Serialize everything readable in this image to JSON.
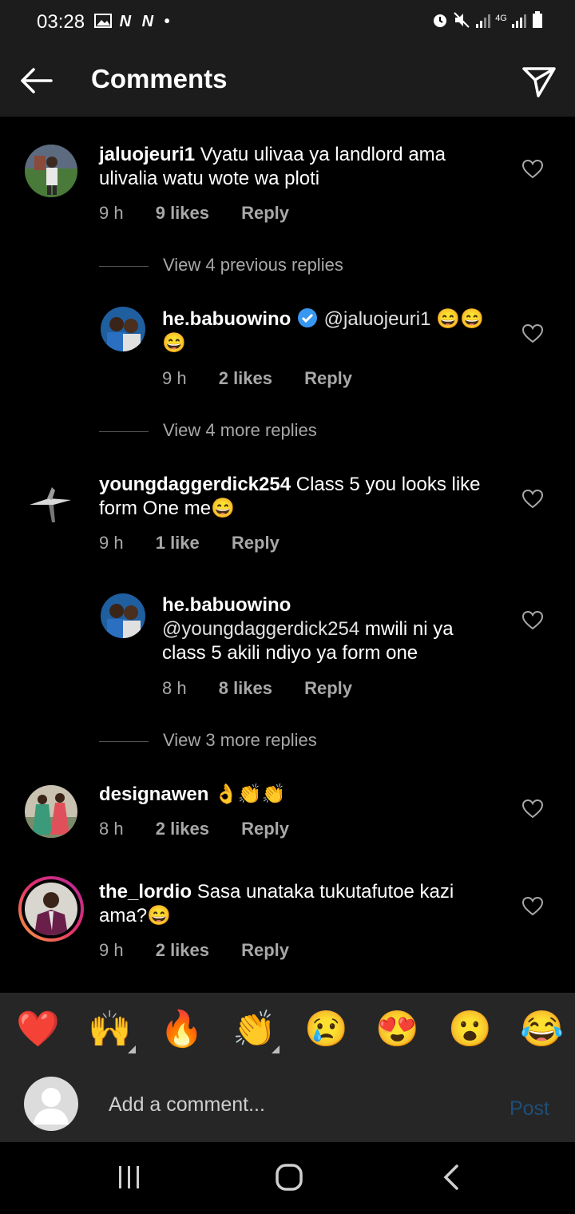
{
  "status_bar": {
    "time": "03:28",
    "left_icons": "N N",
    "network": "4G"
  },
  "header": {
    "title": "Comments"
  },
  "comments": [
    {
      "username": "jaluojeuri1",
      "text": "Vyatu ulivaa ya landlord ama ulivalia watu wote wa ploti",
      "time": "9 h",
      "likes": "9 likes",
      "reply": "Reply"
    },
    {
      "username": "he.babuowino",
      "mention": "@jaluojeuri1",
      "text": "😄😄😄",
      "time": "9 h",
      "likes": "2 likes",
      "reply": "Reply"
    },
    {
      "username": "youngdaggerdick254",
      "text": "Class 5 you looks like form One me😄",
      "time": "9 h",
      "likes": "1 like",
      "reply": "Reply"
    },
    {
      "username": "he.babuowino",
      "mention": "@youngdaggerdick254",
      "text": "mwili ni ya class 5 akili ndiyo ya form one",
      "time": "8 h",
      "likes": "8 likes",
      "reply": "Reply"
    },
    {
      "username": "designawen",
      "text": "👌👏👏",
      "time": "8 h",
      "likes": "2 likes",
      "reply": "Reply"
    },
    {
      "username": "the_lordio",
      "text": "Sasa unataka tukutafutoe kazi ama?😄",
      "time": "9 h",
      "likes": "2 likes",
      "reply": "Reply"
    }
  ],
  "view_links": {
    "previous": "View 4 previous replies",
    "more1": "View 4 more replies",
    "more2": "View 3 more replies"
  },
  "emoji_bar": [
    "❤️",
    "🙌",
    "🔥",
    "👏",
    "😢",
    "😍",
    "😮",
    "😂"
  ],
  "input": {
    "placeholder": "Add a comment...",
    "post_label": "Post"
  },
  "colors": {
    "background": "#000000",
    "header": "#1c1c1c",
    "secondary_text": "#a8a8a8",
    "verified": "#3897f0",
    "post": "#1f4e79"
  }
}
